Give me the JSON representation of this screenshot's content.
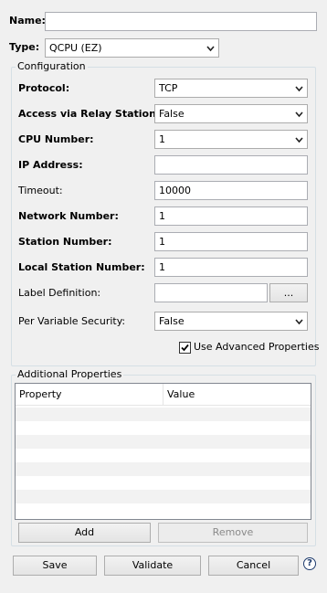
{
  "name": {
    "label": "Name:",
    "value": ""
  },
  "type": {
    "label": "Type:",
    "value": "QCPU (EZ)"
  },
  "configuration": {
    "title": "Configuration",
    "protocol": {
      "label": "Protocol:",
      "value": "TCP"
    },
    "relay": {
      "label": "Access via Relay Station:",
      "value": "False"
    },
    "cpu_number": {
      "label": "CPU Number:",
      "value": "1"
    },
    "ip_address": {
      "label": "IP Address:",
      "value": ""
    },
    "timeout": {
      "label": "Timeout:",
      "value": "10000"
    },
    "network_number": {
      "label": "Network Number:",
      "value": "1"
    },
    "station_number": {
      "label": "Station Number:",
      "value": "1"
    },
    "local_station_number": {
      "label": "Local Station Number:",
      "value": "1"
    },
    "label_definition": {
      "label": "Label Definition:",
      "value": "",
      "browse_label": "..."
    },
    "per_variable_security": {
      "label": "Per Variable Security:",
      "value": "False"
    },
    "use_advanced": {
      "label": "Use Advanced Properties",
      "checked": true
    }
  },
  "additional": {
    "title": "Additional Properties",
    "columns": [
      "Property",
      "Value"
    ],
    "add_label": "Add",
    "remove_label": "Remove"
  },
  "footer": {
    "save_label": "Save",
    "validate_label": "Validate",
    "cancel_label": "Cancel",
    "help_glyph": "?"
  },
  "icons": {
    "dropdown": "chevron-down-icon",
    "help": "help-icon",
    "check": "checkmark-icon"
  }
}
